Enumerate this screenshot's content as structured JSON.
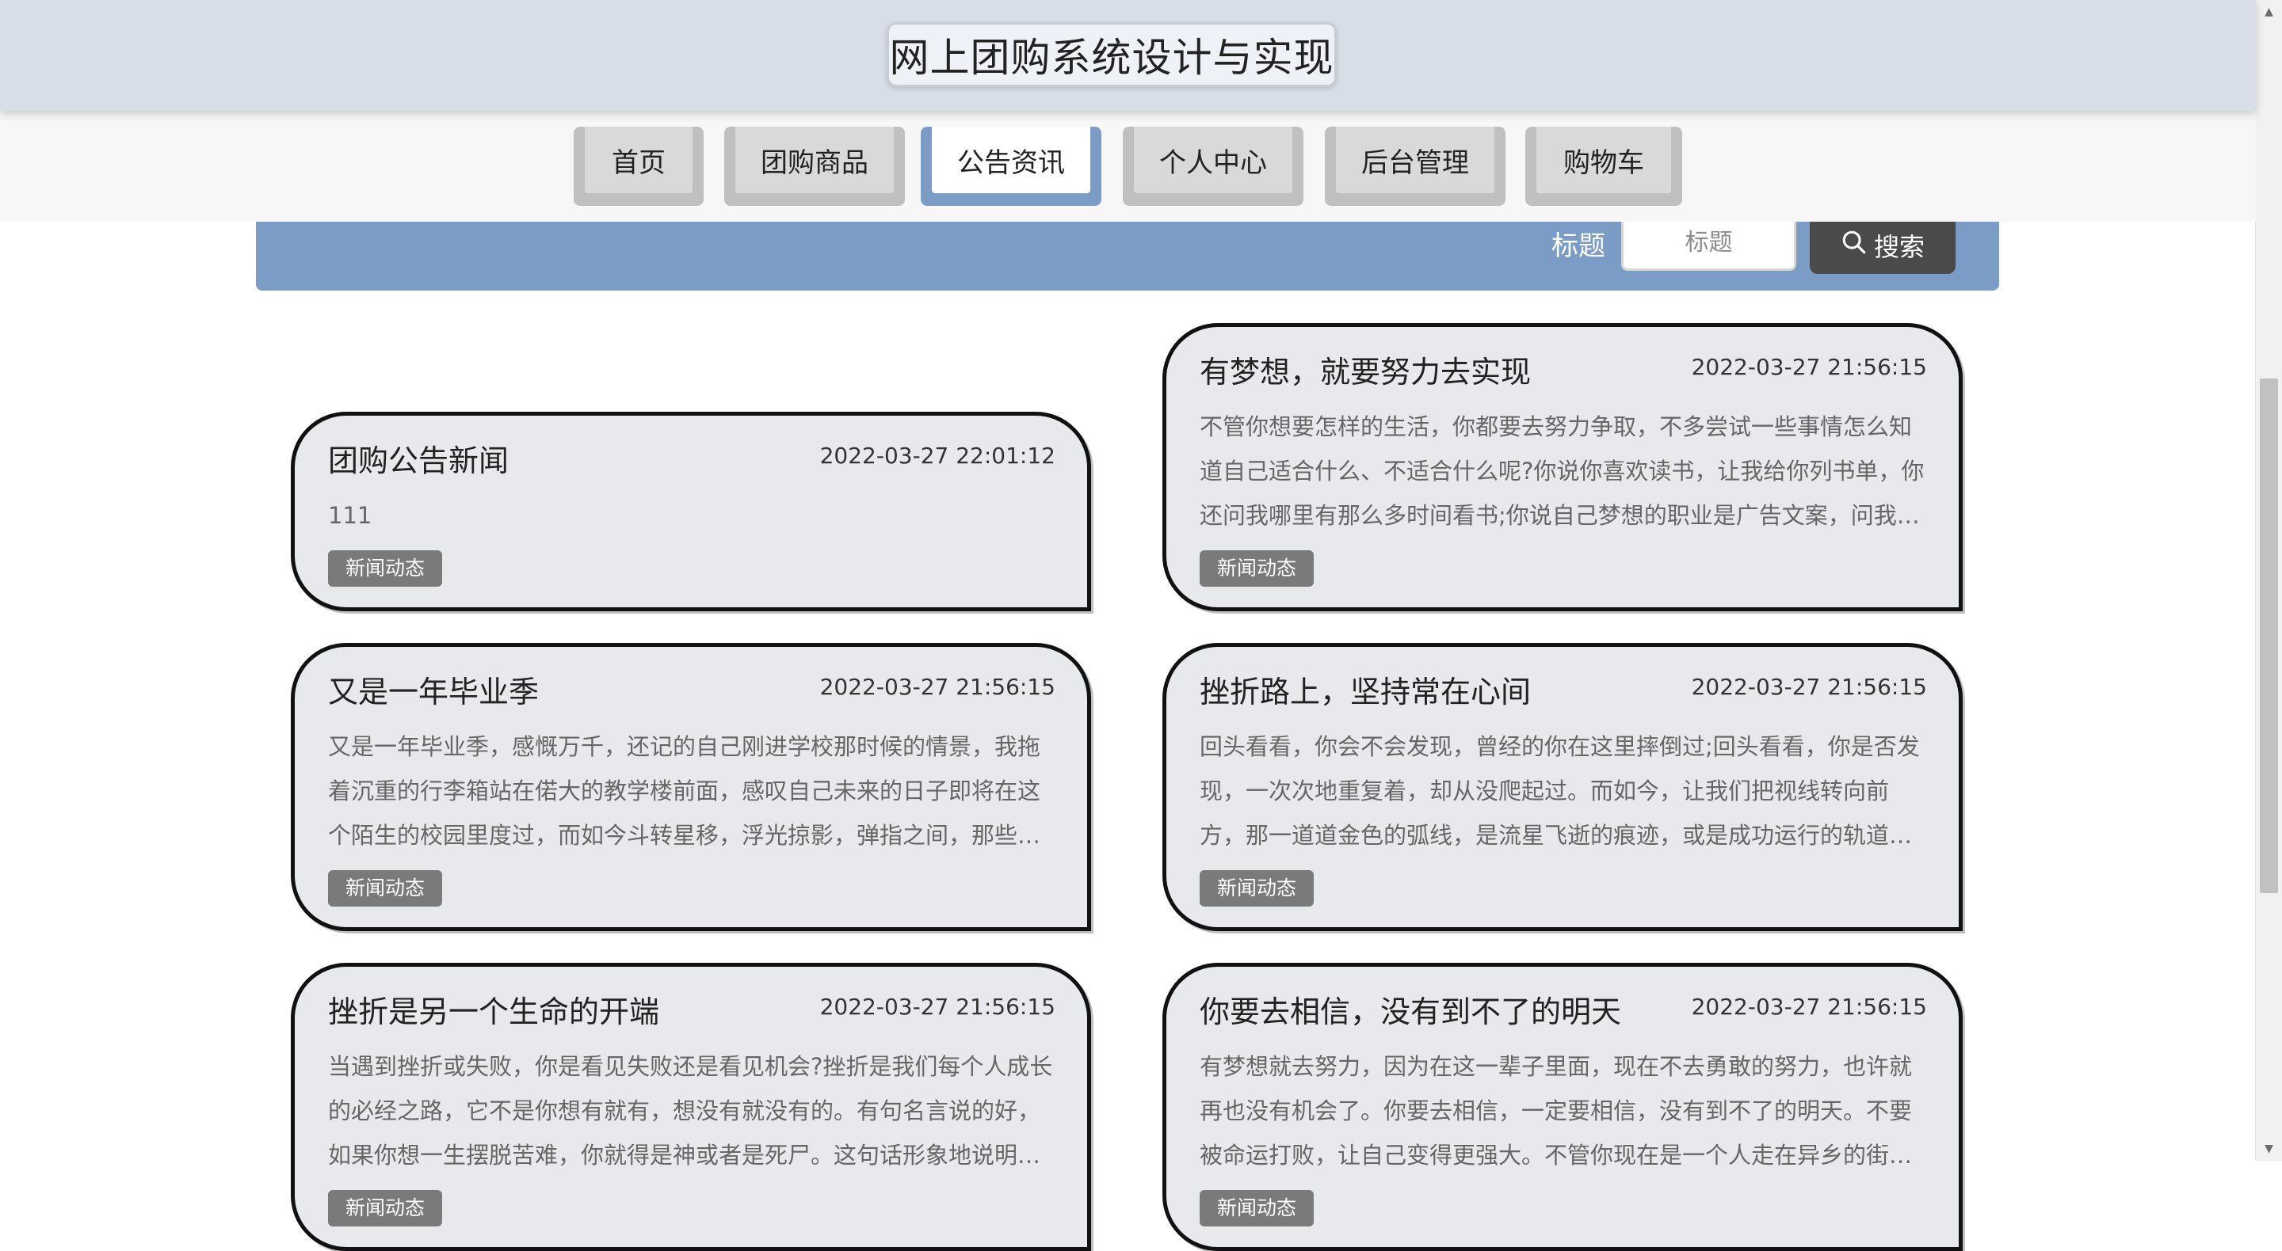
{
  "header": {
    "title": "网上团购系统设计与实现"
  },
  "nav": {
    "items": [
      {
        "label": "首页"
      },
      {
        "label": "团购商品"
      },
      {
        "label": "公告资讯"
      },
      {
        "label": "个人中心"
      },
      {
        "label": "后台管理"
      },
      {
        "label": "购物车"
      }
    ],
    "active_index": 2
  },
  "search": {
    "label": "标题",
    "placeholder": "标题",
    "button_label": "搜索"
  },
  "news": [
    {
      "title": "团购公告新闻",
      "time": "2022-03-27 22:01:12",
      "content": "111",
      "tag": "新闻动态"
    },
    {
      "title": "有梦想，就要努力去实现",
      "time": "2022-03-27 21:56:15",
      "content": "不管你想要怎样的生活，你都要去努力争取，不多尝试一些事情怎么知道自己适合什么、不适合什么呢?你说你喜欢读书，让我给你列书单，你还问我哪里有那么多时间看书;你说自己梦想的职业是广告文案，问我如何成为一名广告文案……",
      "tag": "新闻动态"
    },
    {
      "title": "又是一年毕业季",
      "time": "2022-03-27 21:56:15",
      "content": "又是一年毕业季，感慨万千，还记的自己刚进学校那时候的情景，我拖着沉重的行李箱站在偌大的教学楼前面，感叹自己未来的日子即将在这个陌生的校园里度过，而如今斗转星移，浮光掠影，弹指之间，那些青葱岁月……",
      "tag": "新闻动态"
    },
    {
      "title": "挫折路上，坚持常在心间",
      "time": "2022-03-27 21:56:15",
      "content": "回头看看，你会不会发现，曾经的你在这里摔倒过;回头看看，你是否发现，一次次地重复着，却从没爬起过。而如今，让我们把视线转向前方，那一道道金色的弧线，是流星飞逝的痕迹，或是成功运行的轨道。今天……",
      "tag": "新闻动态"
    },
    {
      "title": "挫折是另一个生命的开端",
      "time": "2022-03-27 21:56:15",
      "content": "当遇到挫折或失败，你是看见失败还是看见机会?挫折是我们每个人成长的必经之路，它不是你想有就有，想没有就没有的。有句名言说的好，如果你想一生摆脱苦难，你就得是神或者是死尸。这句话形象地说明了挫折……",
      "tag": "新闻动态"
    },
    {
      "title": "你要去相信，没有到不了的明天",
      "time": "2022-03-27 21:56:15",
      "content": "有梦想就去努力，因为在这一辈子里面，现在不去勇敢的努力，也许就再也没有机会了。你要去相信，一定要相信，没有到不了的明天。不要被命运打败，让自己变得更强大。不管你现在是一个人走在异乡的街道上始……",
      "tag": "新闻动态"
    }
  ]
}
